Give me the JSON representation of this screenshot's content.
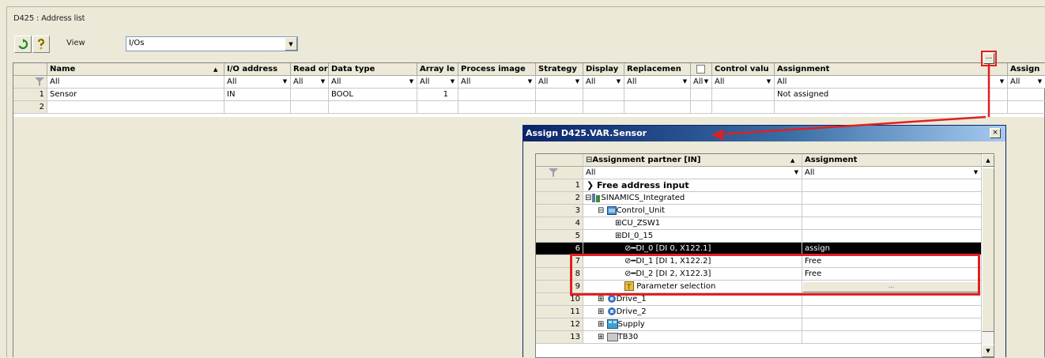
{
  "window": {
    "title": "D425 : Address list"
  },
  "toolbar": {
    "refresh_icon": "refresh-icon",
    "help_icon": "help-icon",
    "view_label": "View",
    "view_value": "I/Os"
  },
  "grid": {
    "columns": [
      "Name",
      "I/O address",
      "Read or",
      "Data type",
      "Array le",
      "Process image",
      "Strategy",
      "Display",
      "Replacemen",
      "Control valu",
      "Assignment",
      "Assign"
    ],
    "filter_value": "All",
    "rows": [
      {
        "num": "1",
        "name": "Sensor",
        "io_address": "IN",
        "data_type": "BOOL",
        "array_len": "1",
        "assignment": "Not assigned"
      },
      {
        "num": "2",
        "name": "",
        "io_address": "",
        "data_type": "",
        "array_len": "",
        "assignment": ""
      }
    ],
    "ellipsis": "..."
  },
  "dialog": {
    "title": "Assign D425.VAR.Sensor",
    "close_label": "×",
    "col_partner": "Assignment partner [IN]",
    "col_assignment": "Assignment",
    "filter_value": "All",
    "tree": [
      {
        "num": "1",
        "label": "Free address input",
        "assignment": ""
      },
      {
        "num": "2",
        "label": "SINAMICS_Integrated",
        "assignment": ""
      },
      {
        "num": "3",
        "label": "Control_Unit",
        "assignment": ""
      },
      {
        "num": "4",
        "label": "CU_ZSW1",
        "assignment": ""
      },
      {
        "num": "5",
        "label": "DI_0_15",
        "assignment": ""
      },
      {
        "num": "6",
        "label": "DI_0 [DI 0, X122.1]",
        "assignment": "assign"
      },
      {
        "num": "7",
        "label": "DI_1 [DI 1, X122.2]",
        "assignment": "Free"
      },
      {
        "num": "8",
        "label": "DI_2 [DI 2, X122.3]",
        "assignment": "Free"
      },
      {
        "num": "9",
        "label": "Parameter selection",
        "assignment": ""
      },
      {
        "num": "10",
        "label": "Drive_1",
        "assignment": ""
      },
      {
        "num": "11",
        "label": "Drive_2",
        "assignment": ""
      },
      {
        "num": "12",
        "label": "Supply",
        "assignment": ""
      },
      {
        "num": "13",
        "label": "TB30",
        "assignment": ""
      }
    ],
    "assign_button": "..."
  },
  "colors": {
    "annotation": "#e02020",
    "title_bar": "#0a246a",
    "selection": "#000000"
  }
}
